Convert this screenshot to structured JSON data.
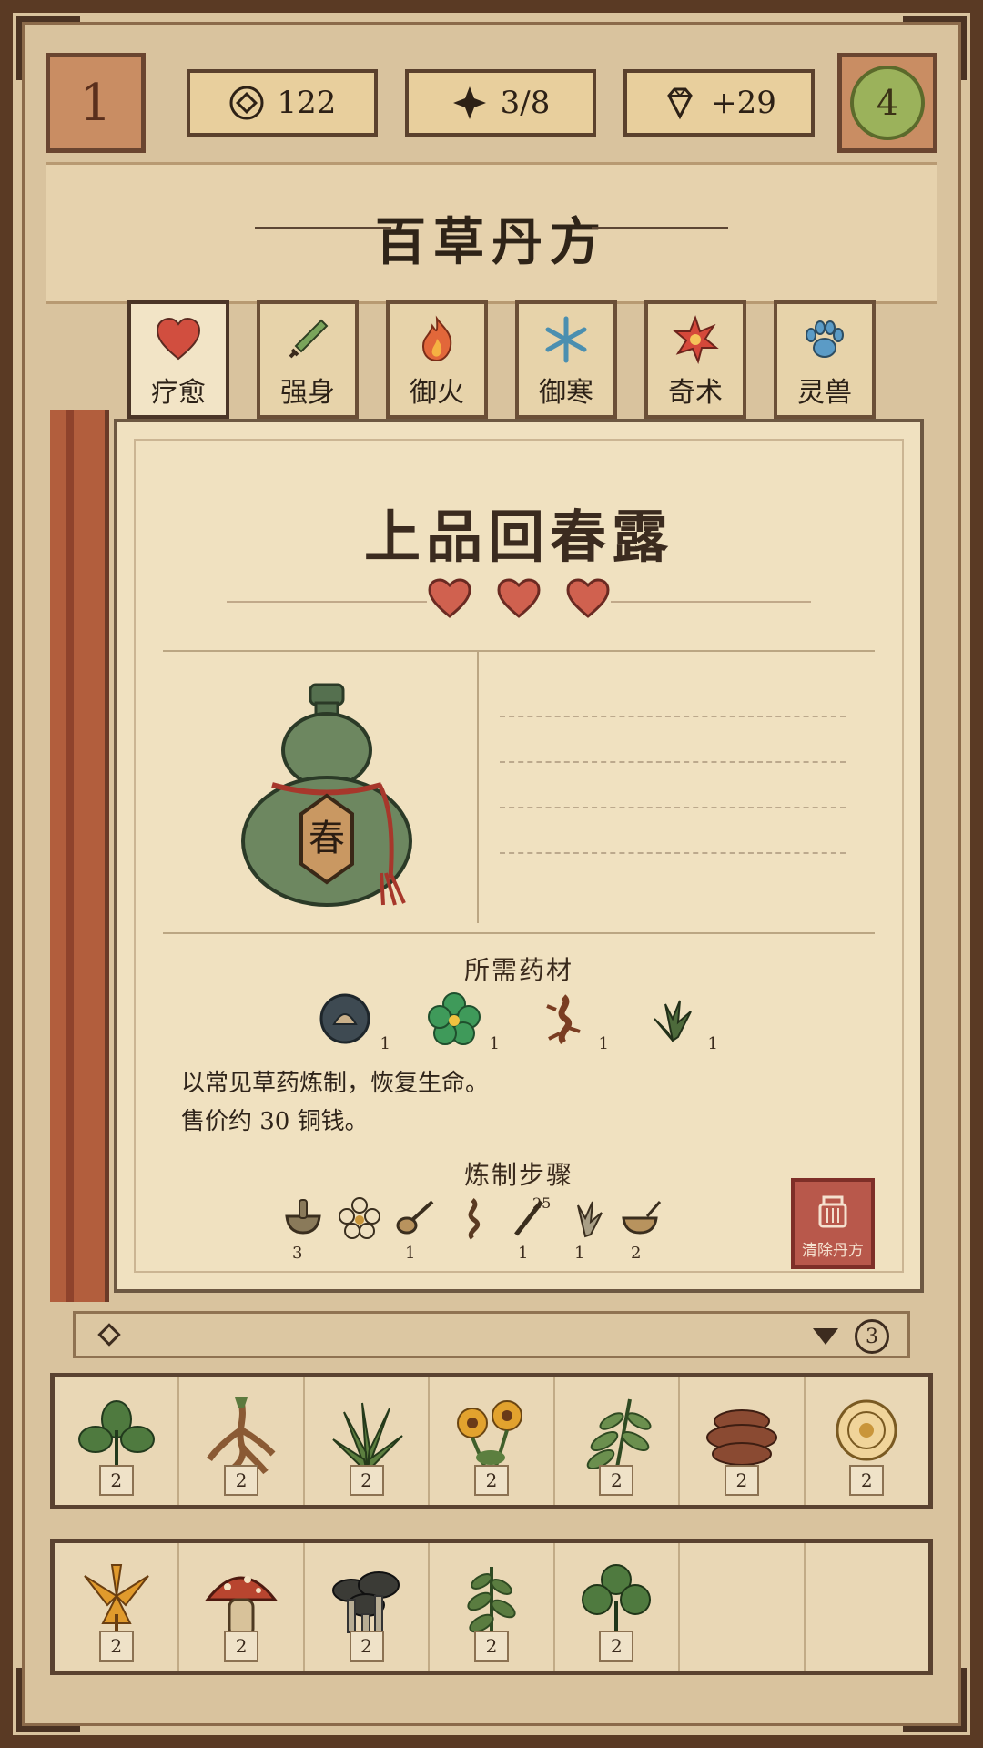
{
  "top_bar": {
    "level": "1",
    "coins": "122",
    "progress": "3/8",
    "gems": "+29",
    "badge": "4"
  },
  "title": "百草丹方",
  "tabs": [
    {
      "label": "疗愈",
      "icon": "heart-icon",
      "active": true
    },
    {
      "label": "强身",
      "icon": "sword-icon"
    },
    {
      "label": "御火",
      "icon": "flame-icon"
    },
    {
      "label": "御寒",
      "icon": "snowflake-icon"
    },
    {
      "label": "奇术",
      "icon": "star-burst-icon"
    },
    {
      "label": "灵兽",
      "icon": "paw-icon"
    }
  ],
  "recipe": {
    "name": "上品回春露",
    "hearts": 3,
    "bottle_label": "春",
    "ingredients_title": "所需药材",
    "ingredients": [
      {
        "icon": "shell-icon",
        "count": "1"
      },
      {
        "icon": "clover-icon",
        "count": "1"
      },
      {
        "icon": "root-icon",
        "count": "1"
      },
      {
        "icon": "herb-leaves-icon",
        "count": "1"
      }
    ],
    "desc_line1": "以常见草药炼制，恢复生命。",
    "desc_line2": "售价约 30 铜钱。",
    "steps_title": "炼制步骤",
    "steps": [
      {
        "icon": "mortar-icon",
        "count": "3"
      },
      {
        "icon": "flower-icon",
        "count": ""
      },
      {
        "icon": "spoon-icon",
        "count": "1"
      },
      {
        "icon": "root-icon",
        "count": ""
      },
      {
        "icon": "stick-icon",
        "count": "1",
        "sub": "25"
      },
      {
        "icon": "herb-leaves-icon",
        "count": "1"
      },
      {
        "icon": "bowl-icon",
        "count": "2"
      }
    ],
    "clear_button": "清除丹方"
  },
  "pager": {
    "page_badge": "3"
  },
  "inventory_row1": [
    {
      "icon": "leafy-plant-icon",
      "qty": "2"
    },
    {
      "icon": "ginseng-root-icon",
      "qty": "2"
    },
    {
      "icon": "grass-icon",
      "qty": "2"
    },
    {
      "icon": "yellow-flowers-icon",
      "qty": "2"
    },
    {
      "icon": "fern-icon",
      "qty": "2"
    },
    {
      "icon": "fungus-icon",
      "qty": "2"
    },
    {
      "icon": "chrysanthemum-icon",
      "qty": "2"
    }
  ],
  "inventory_row2": [
    {
      "icon": "orange-lily-icon",
      "qty": "2"
    },
    {
      "icon": "red-mushroom-icon",
      "qty": "2"
    },
    {
      "icon": "dark-mushrooms-icon",
      "qty": "2"
    },
    {
      "icon": "sprout-icon",
      "qty": "2"
    },
    {
      "icon": "clover-plant-icon",
      "qty": "2"
    },
    {
      "icon": "empty-slot",
      "qty": ""
    },
    {
      "icon": "empty-slot",
      "qty": ""
    }
  ],
  "colors": {
    "heart": "#d14e3f",
    "bottle": "#6d8760",
    "parchment": "#f0e1c0",
    "frame": "#5a3a24"
  }
}
